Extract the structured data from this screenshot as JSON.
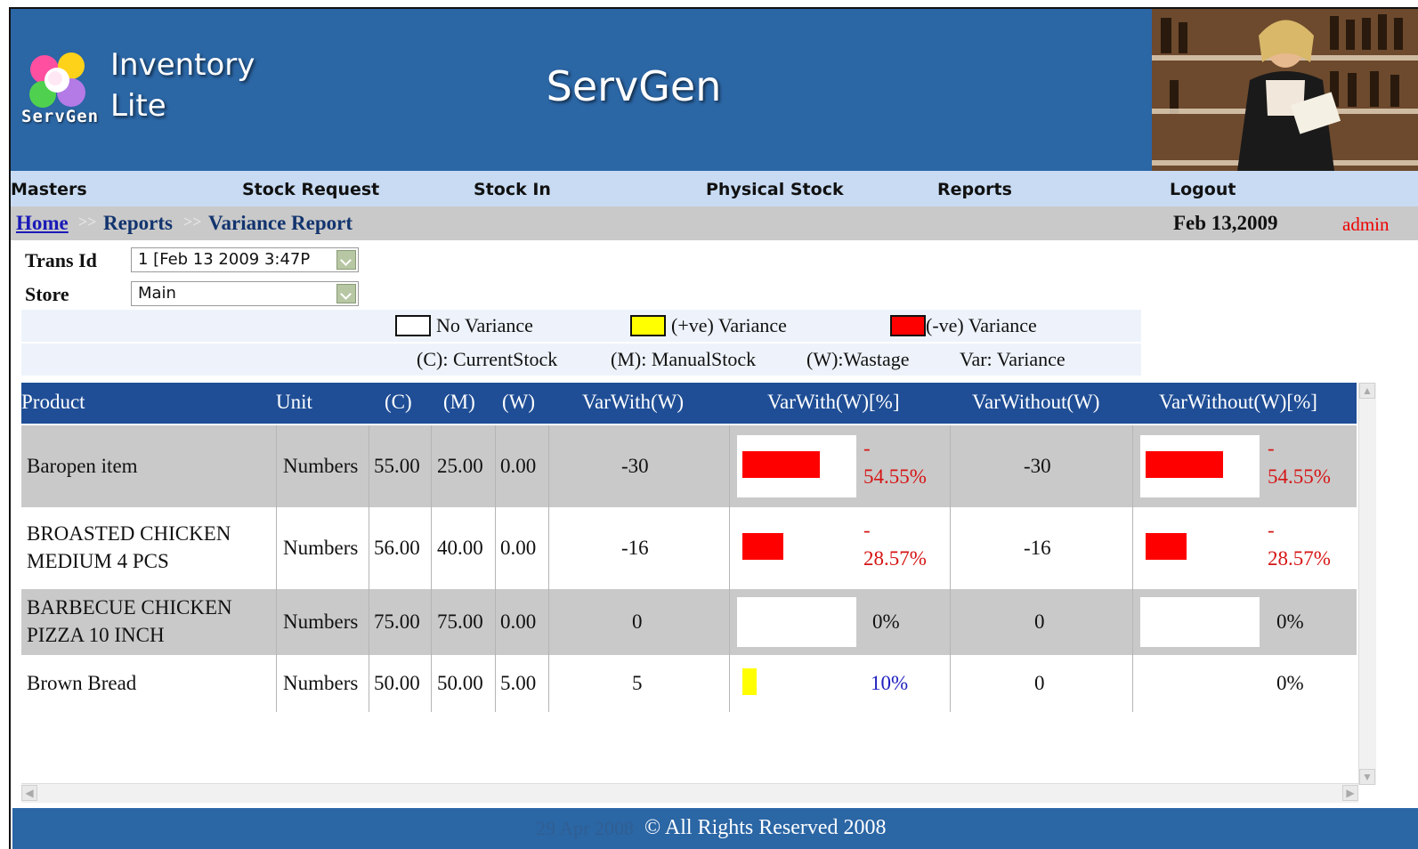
{
  "header": {
    "app_name_line1": "Inventory",
    "app_name_line2": "Lite",
    "logo_text": "ServGen",
    "center_title": "ServGen"
  },
  "nav": {
    "items": [
      "Masters",
      "Stock Request",
      "Stock In",
      "Physical Stock",
      "Reports",
      "Logout"
    ]
  },
  "breadcrumb": {
    "home": "Home",
    "separator": ">>",
    "reports": "Reports",
    "current": "Variance Report",
    "date": "Feb 13,2009",
    "user": "admin"
  },
  "filters": {
    "trans_label": "Trans Id",
    "trans_value": "1 [Feb 13 2009 3:47P",
    "store_label": "Store",
    "store_value": "Main"
  },
  "legend": {
    "no_variance": "No Variance",
    "pos_variance": "(+ve) Variance",
    "neg_variance": "(-ve) Variance",
    "current": "(C): CurrentStock",
    "manual": "(M): ManualStock",
    "wastage": "(W):Wastage",
    "var": "Var: Variance",
    "colors": {
      "none": "#ffffff",
      "positive": "#ffff00",
      "negative": "#ff0000"
    }
  },
  "table": {
    "columns": [
      "Product",
      "Unit",
      "(C)",
      "(M)",
      "(W)",
      "VarWith(W)",
      "VarWith(W)[%]",
      "VarWithout(W)",
      "VarWithout(W)[%]"
    ],
    "rows": [
      {
        "product_line1": "Baropen item",
        "product_line2": "",
        "unit": "Numbers",
        "c": "55.00",
        "m": "25.00",
        "w": "0.00",
        "var_with": "-30",
        "pct_with_sign": "-",
        "pct_with": "54.55%",
        "var_without": "-30",
        "pct_without_sign": "-",
        "pct_without": "54.55%",
        "bar_with_fraction": 0.5455,
        "bar_with_color": "#ff0000",
        "bar_without_fraction": 0.5455,
        "bar_without_color": "#ff0000"
      },
      {
        "product_line1": "BROASTED CHICKEN",
        "product_line2": "MEDIUM 4 PCS",
        "unit": "Numbers",
        "c": "56.00",
        "m": "40.00",
        "w": "0.00",
        "var_with": "-16",
        "pct_with_sign": "-",
        "pct_with": "28.57%",
        "var_without": "-16",
        "pct_without_sign": "-",
        "pct_without": "28.57%",
        "bar_with_fraction": 0.2857,
        "bar_with_color": "#ff0000",
        "bar_without_fraction": 0.2857,
        "bar_without_color": "#ff0000"
      },
      {
        "product_line1": "BARBECUE CHICKEN",
        "product_line2": "PIZZA 10 INCH",
        "unit": "Numbers",
        "c": "75.00",
        "m": "75.00",
        "w": "0.00",
        "var_with": "0",
        "pct_with_sign": "",
        "pct_with": "0%",
        "var_without": "0",
        "pct_without_sign": "",
        "pct_without": "0%",
        "bar_with_fraction": 0,
        "bar_with_color": "#ffffff",
        "bar_without_fraction": 0,
        "bar_without_color": "#ffffff"
      },
      {
        "product_line1": "Brown Bread",
        "product_line2": "",
        "unit": "Numbers",
        "c": "50.00",
        "m": "50.00",
        "w": "5.00",
        "var_with": "5",
        "pct_with_sign": "",
        "pct_with": "10%",
        "var_without": "0",
        "pct_without_sign": "",
        "pct_without": "0%",
        "bar_with_fraction": 0.1,
        "bar_with_color": "#ffff00",
        "bar_without_fraction": 0,
        "bar_without_color": "#ffffff"
      }
    ]
  },
  "footer": {
    "faint_text": "29 Apr 2008",
    "copyright": "© All Rights Reserved 2008"
  }
}
